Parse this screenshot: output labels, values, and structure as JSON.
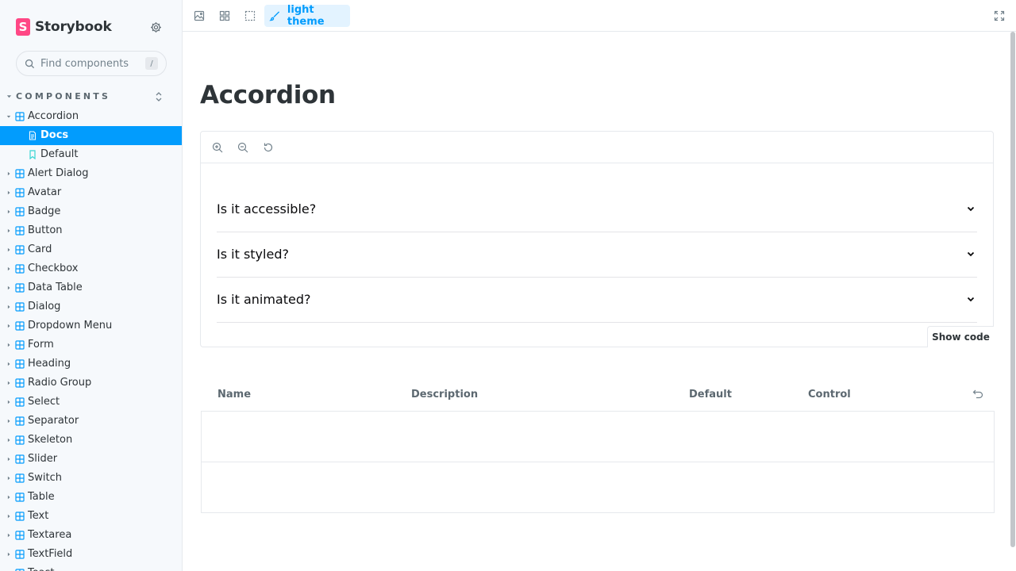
{
  "sidebar": {
    "brand": "Storybook",
    "brand_letter": "S",
    "search_placeholder": "Find components",
    "search_shortcut": "/",
    "section_label": "COMPONENTS",
    "expanded": {
      "label": "Accordion",
      "children": [
        {
          "label": "Docs",
          "icon": "document-icon",
          "active": true
        },
        {
          "label": "Default",
          "icon": "bookmark-icon",
          "active": false
        }
      ]
    },
    "items": [
      "Alert Dialog",
      "Avatar",
      "Badge",
      "Button",
      "Card",
      "Checkbox",
      "Data Table",
      "Dialog",
      "Dropdown Menu",
      "Form",
      "Heading",
      "Radio Group",
      "Select",
      "Separator",
      "Skeleton",
      "Slider",
      "Switch",
      "Table",
      "Text",
      "Textarea",
      "TextField",
      "Toast"
    ]
  },
  "toolbar": {
    "theme_label": "light theme",
    "icons": [
      "image-icon",
      "grid-icon",
      "outline-icon",
      "paintbrush-icon",
      "fullscreen-icon"
    ]
  },
  "main": {
    "title": "Accordion",
    "accordion": [
      {
        "question": "Is it accessible?"
      },
      {
        "question": "Is it styled?"
      },
      {
        "question": "Is it animated?"
      }
    ],
    "show_code_label": "Show code",
    "args_table": {
      "headers": [
        "Name",
        "Description",
        "Default",
        "Control"
      ],
      "rows": 2
    }
  },
  "colors": {
    "accent": "#029cfd",
    "brand": "#ff4785",
    "sidebar_bg": "#f6f9fc",
    "component_icon": "#029cfd",
    "story_icon": "#37d5d3"
  }
}
